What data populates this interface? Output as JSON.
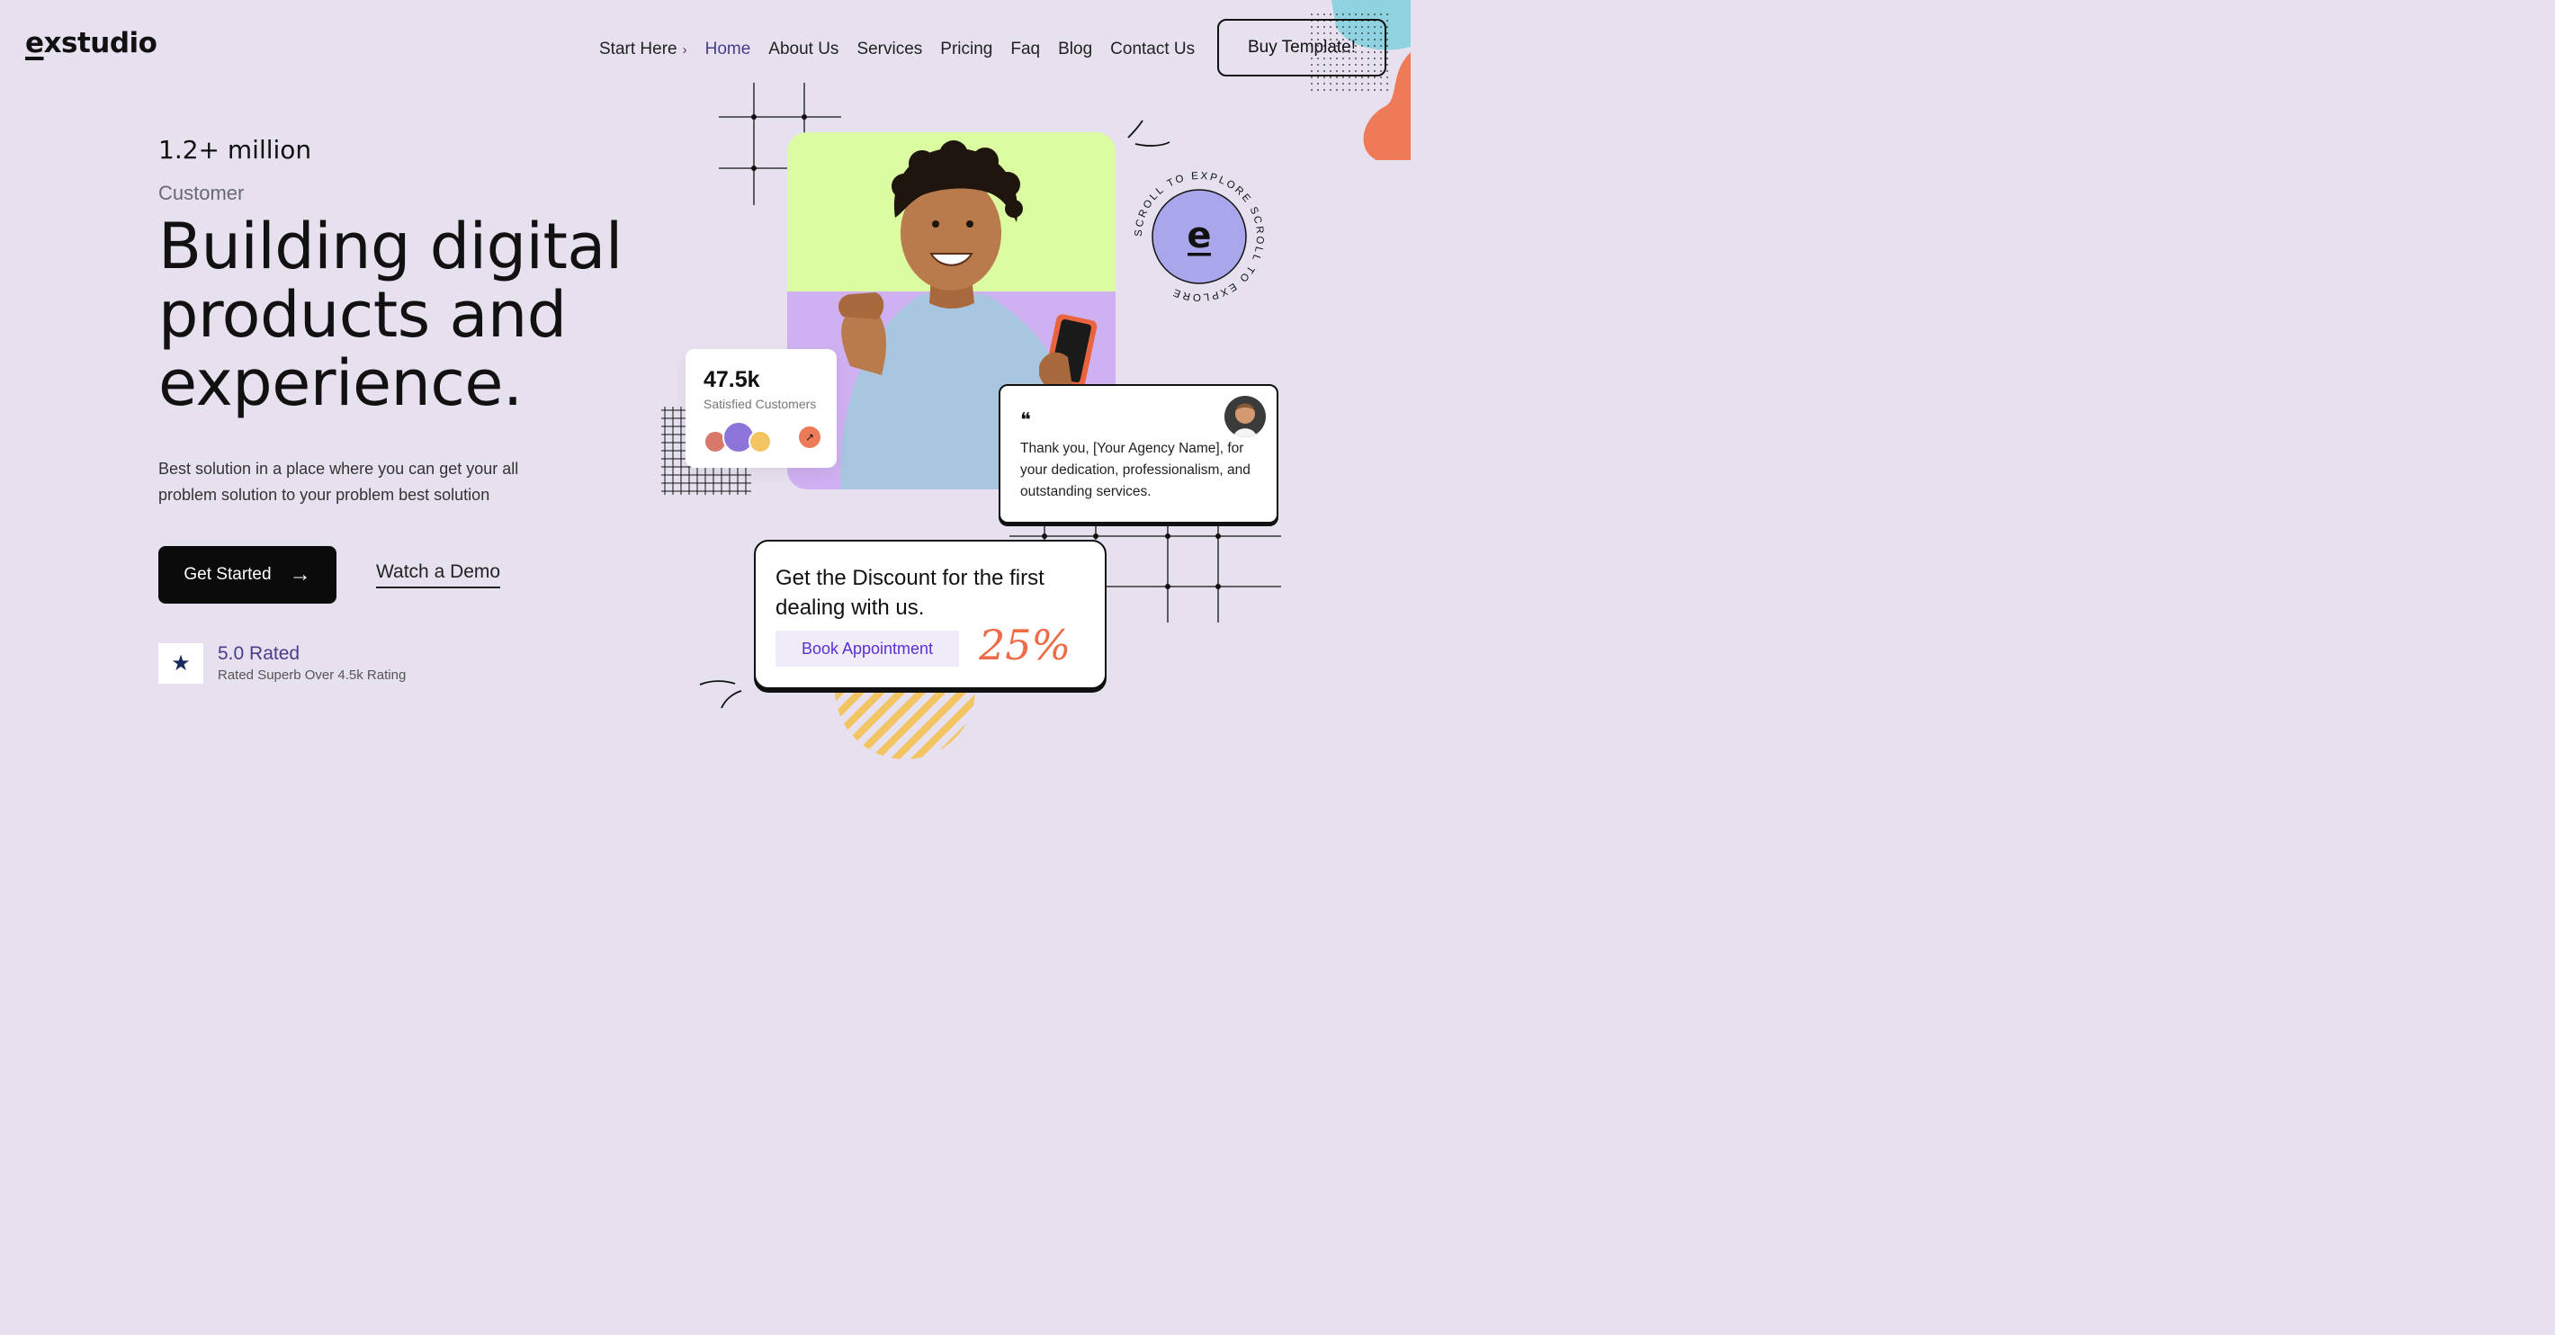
{
  "brand": {
    "logo_first": "e",
    "logo_rest": "xstudio"
  },
  "nav": {
    "items": [
      {
        "label": "Start Here",
        "chevron": "›"
      },
      {
        "label": "Home"
      },
      {
        "label": "About Us"
      },
      {
        "label": "Services"
      },
      {
        "label": "Pricing"
      },
      {
        "label": "Faq"
      },
      {
        "label": "Blog"
      },
      {
        "label": "Contact Us"
      }
    ],
    "active": "Home",
    "cta": "Buy Template!"
  },
  "hero": {
    "stat_value": "1.2+ million",
    "stat_label": "Customer",
    "headline": "Building digital products and experience.",
    "description": "Best solution in a place where you can get your all problem solution to your problem best solution",
    "primary_button": "Get Started",
    "primary_button_icon": "arrow-right-icon",
    "secondary_button": "Watch a Demo",
    "rating_icon": "star-icon",
    "rating_title": "5.0 Rated",
    "rating_sub": "Rated Superb Over 4.5k Rating"
  },
  "stat_card": {
    "value": "47.5k",
    "label": "Satisfied Customers",
    "arrow_icon": "arrow-up-right-icon"
  },
  "badge": {
    "letter": "e",
    "ring_text": "SCROLL TO EXPLORE SCROLL TO EXPLORE "
  },
  "testimonial": {
    "icon": "quote-icon",
    "text": "Thank you, [Your Agency Name], for your dedication, professionalism, and outstanding services."
  },
  "discount": {
    "title": "Get the Discount for the first dealing with us.",
    "button": "Book Appointment",
    "percent": "25%"
  },
  "colors": {
    "background": "#e7e0ef",
    "lime": "#dcfca1",
    "lavender": "#cfb0f1",
    "accent_orange": "#ef6a47",
    "accent_purple": "#5a2fd0",
    "badge_fill": "#a9a6eb"
  }
}
